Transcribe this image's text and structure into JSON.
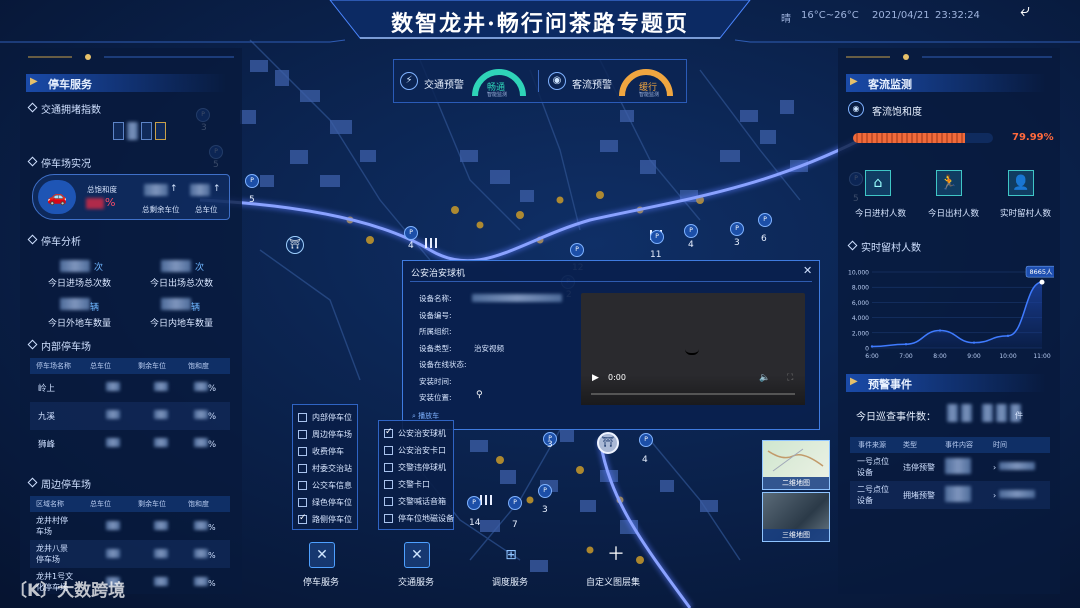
{
  "header": {
    "title": "数智龙井·畅行问茶路专题页",
    "weather": "晴",
    "temperature": "16°C~26°C",
    "date": "2021/04/21",
    "time": "23:32:24"
  },
  "left": {
    "parking_service": {
      "title": "停车服务"
    },
    "traffic_index": {
      "label": "交通拥堵指数"
    },
    "parking_status": {
      "label": "停车场实况",
      "saturation_label": "总饱和度",
      "percent": "%",
      "remaining_label": "总剩余车位",
      "total_label": "总车位"
    },
    "parking_analysis": {
      "label": "停车分析",
      "items": [
        {
          "unit": "次",
          "label": "今日进场总次数"
        },
        {
          "unit": "次",
          "label": "今日出场总次数"
        },
        {
          "unit": "辆",
          "label": "今日外地车数量"
        },
        {
          "unit": "辆",
          "label": "今日内地车数量"
        }
      ]
    },
    "inner_lots": {
      "label": "内部停车场",
      "headers": [
        "停车场名称",
        "总车位",
        "剩余车位",
        "饱和度"
      ],
      "rows": [
        {
          "name": "岭上",
          "pct": "%"
        },
        {
          "name": "九溪",
          "pct": "%"
        },
        {
          "name": "狮峰",
          "pct": "%"
        }
      ]
    },
    "outer_lots": {
      "label": "周边停车场",
      "headers": [
        "区域名称",
        "总车位",
        "剩余车位",
        "饱和度"
      ],
      "rows": [
        {
          "name1": "龙井村停",
          "name2": "车场",
          "pct": "%"
        },
        {
          "name1": "龙井八景",
          "name2": "停车场",
          "pct": "%"
        },
        {
          "name1": "龙井1号文",
          "name2": "化停车场",
          "pct": "%"
        }
      ]
    }
  },
  "alerts": {
    "traffic_label": "交通预警",
    "traffic_status": "畅通",
    "traffic_sub": "智能监测",
    "crowd_label": "客流预警",
    "crowd_status": "缓行",
    "crowd_sub": "智能监测"
  },
  "right": {
    "flow": {
      "title": "客流监测",
      "saturation_label": "客流饱和度",
      "saturation_value": "79.99%"
    },
    "stats": [
      {
        "label": "今日进村人数"
      },
      {
        "label": "今日出村人数"
      },
      {
        "label": "实时留村人数"
      }
    ],
    "realtime_label": "实时留村人数",
    "warning": {
      "title": "预警事件",
      "patrol_label": "今日巡查事件数：",
      "patrol_unit": "件",
      "headers": [
        "事件来源",
        "类型",
        "事件内容",
        "时间"
      ],
      "rows": [
        {
          "src1": "一号点位",
          "src2": "设备",
          "type": "违停预警"
        },
        {
          "src1": "二号点位",
          "src2": "设备",
          "type": "拥堵预警"
        }
      ]
    }
  },
  "chart_data": {
    "type": "area",
    "x": [
      "6:00",
      "7:00",
      "8:00",
      "9:00",
      "10:00",
      "11:00"
    ],
    "values": [
      200,
      500,
      2300,
      700,
      1600,
      8665
    ],
    "ylim": [
      0,
      10000
    ],
    "yticks": [
      "10,000",
      "8,000",
      "6,000",
      "4,000",
      "2,000",
      "0"
    ],
    "peak_label": "8665人",
    "colors": {
      "line": "#3f7bff",
      "fill": "#1b3f98"
    }
  },
  "popup": {
    "title": "公安治安球机",
    "fields": [
      "设备名称:",
      "设备编号:",
      "所属组织:",
      "设备类型:",
      "设备在线状态:",
      "安装时间:",
      "安装位置:"
    ],
    "device_type": "治安视频",
    "locate": "播放车",
    "time": "0:00"
  },
  "layers": {
    "left": [
      {
        "label": "内部停车位",
        "checked": false
      },
      {
        "label": "周边停车场",
        "checked": false
      },
      {
        "label": "收费停车",
        "checked": false
      },
      {
        "label": "村委交治站",
        "checked": false
      },
      {
        "label": "公交车信息",
        "checked": false
      },
      {
        "label": "绿色停车位",
        "checked": false
      },
      {
        "label": "路侧停车位",
        "checked": true
      }
    ],
    "right": [
      {
        "label": "公安治安球机",
        "checked": true
      },
      {
        "label": "公安治安卡口",
        "checked": false
      },
      {
        "label": "交警违停球机",
        "checked": false
      },
      {
        "label": "交警卡口",
        "checked": false
      },
      {
        "label": "交警喊话音箱",
        "checked": false
      },
      {
        "label": "停车位地磁设备",
        "checked": false
      }
    ]
  },
  "bottom": {
    "buttons": [
      "停车服务",
      "交通服务",
      "调度服务",
      "自定义图层集"
    ]
  },
  "map_thumbs": {
    "map2d": "二维地图",
    "map3d": "三维地图"
  },
  "map_numbers": [
    "3",
    "5",
    "5",
    "4",
    "2",
    "11",
    "4",
    "3",
    "6",
    "12",
    "4",
    "3",
    "14",
    "7",
    "3",
    "5"
  ],
  "watermark": "大数跨境"
}
